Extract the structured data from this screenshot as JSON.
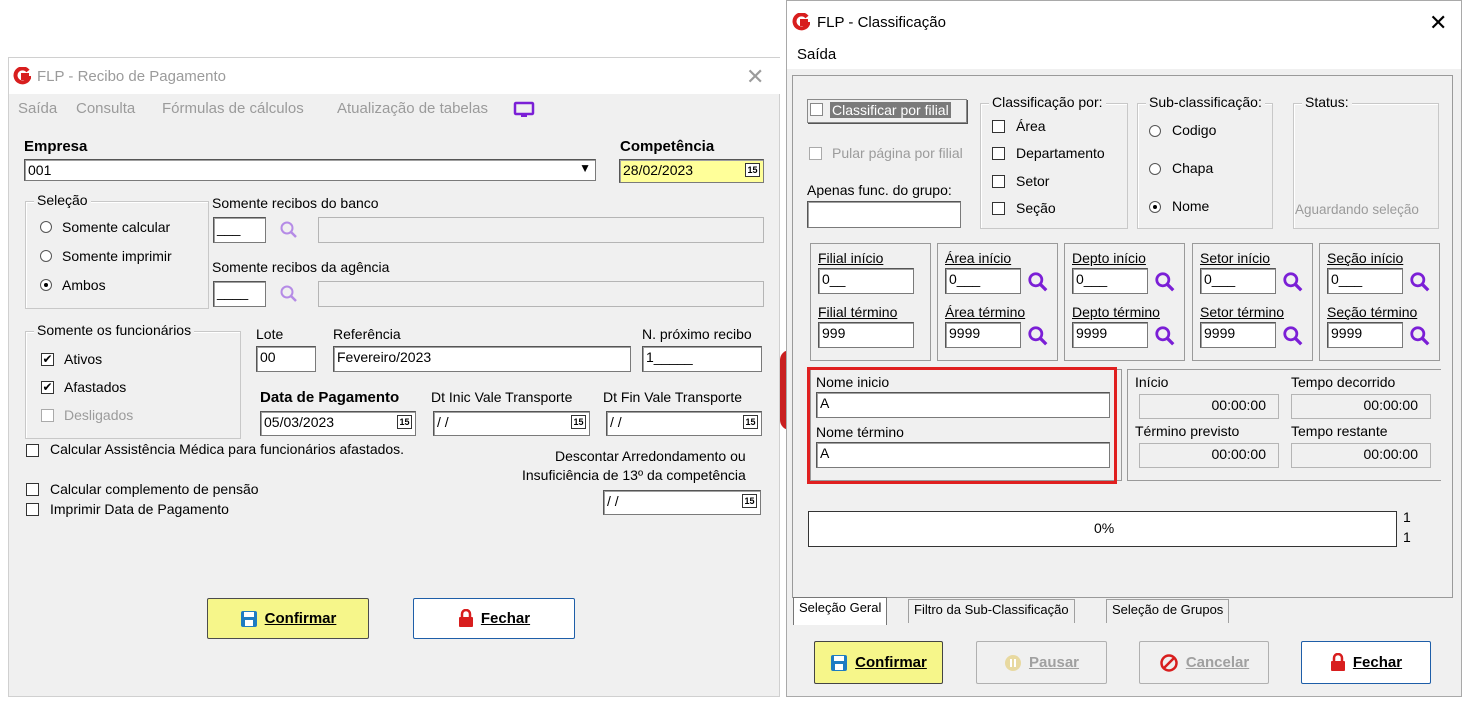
{
  "left": {
    "title": "FLP - Recibo de Pagamento",
    "menu": [
      "Saída",
      "Consulta",
      "Fórmulas de cálculos",
      "Atualização de tabelas"
    ],
    "empresa_label": "Empresa",
    "empresa_value": "001",
    "competencia_label": "Competência",
    "competencia_value": "28/02/2023",
    "selecao_title": "Seleção",
    "selecao_options": [
      "Somente calcular",
      "Somente imprimir",
      "Ambos"
    ],
    "banco_label": "Somente recibos do banco",
    "banco_value": "___",
    "agencia_label": "Somente recibos da agência",
    "agencia_value": "____",
    "func_title": "Somente os funcionários",
    "func_options": [
      "Ativos",
      "Afastados",
      "Desligados"
    ],
    "lote_label": "Lote",
    "lote_value": "00",
    "referencia_label": "Referência",
    "referencia_value": "Fevereiro/2023",
    "proximo_label": "N. próximo recibo",
    "proximo_value": "1_____",
    "data_pag_label": "Data de Pagamento",
    "data_pag_value": "05/03/2023",
    "dt_inic_label": "Dt Inic Vale Transporte",
    "dt_inic_value": "/ /",
    "dt_fin_label": "Dt Fin Vale Transporte",
    "dt_fin_value": "/ /",
    "calc_assist": "Calcular Assistência Médica para funcionários afastados.",
    "descontar_1": "Descontar Arredondamento ou",
    "descontar_2": "Insuficiência de 13º da competência",
    "descontar_value": "/ /",
    "calc_pensao": "Calcular complemento de pensão",
    "imprimir_data": "Imprimir Data de Pagamento",
    "confirmar_label": "Confirmar",
    "fechar_label": "Fechar"
  },
  "right": {
    "title": "FLP - Classificação",
    "menu": [
      "Saída"
    ],
    "classificar_filial": "Classificar por filial",
    "pular_pagina": "Pular página por filial",
    "apenas_grupo": "Apenas func. do grupo:",
    "classificacao_title": "Classificação  por:",
    "classificacao_options": [
      "Área",
      "Departamento",
      "Setor",
      "Seção"
    ],
    "subclass_title": "Sub-classificação:",
    "subclass_options": [
      "Codigo",
      "Chapa",
      "Nome"
    ],
    "status_title": "Status:",
    "status_value": "Aguardando seleção",
    "ranges": [
      {
        "inicio_label": "Filial início",
        "inicio_value": "0__",
        "termino_label": "Filial término",
        "termino_value": "999"
      },
      {
        "inicio_label": "Área início",
        "inicio_value": "0___",
        "termino_label": "Área término",
        "termino_value": "9999"
      },
      {
        "inicio_label": "Depto início",
        "inicio_value": "0___",
        "termino_label": "Depto término",
        "termino_value": "9999"
      },
      {
        "inicio_label": "Setor início",
        "inicio_value": "0___",
        "termino_label": "Setor término",
        "termino_value": "9999"
      },
      {
        "inicio_label": "Seção início",
        "inicio_value": "0___",
        "termino_label": "Seção término",
        "termino_value": "9999"
      }
    ],
    "nome_inicio_label": "Nome inicio",
    "nome_inicio_value": "A",
    "nome_termino_label": "Nome término",
    "nome_termino_value": "A",
    "inicio_label": "Início",
    "inicio_value": "00:00:00",
    "tempo_decorrido_label": "Tempo decorrido",
    "tempo_decorrido_value": "00:00:00",
    "termino_previsto_label": "Término previsto",
    "termino_previsto_value": "00:00:00",
    "tempo_restante_label": "Tempo restante",
    "tempo_restante_value": "00:00:00",
    "progress_text": "0%",
    "progress_fraction": 0,
    "progress_count_top": "1",
    "progress_count_bottom": "1",
    "tabs": [
      "Seleção Geral",
      "Filtro da Sub-Classificação",
      "Seleção de Grupos"
    ],
    "confirmar_label": "Confirmar",
    "pausar_label": "Pausar",
    "cancelar_label": "Cancelar",
    "fechar_label": "Fechar"
  },
  "colors": {
    "window_bg": "#f0f0f0",
    "highlight_yellow": "#ffff99",
    "confirm_bg": "#f6f68a",
    "red_box": "#e02020",
    "brand_red": "#d81e1e",
    "accent_purple": "#7b1fd6"
  }
}
